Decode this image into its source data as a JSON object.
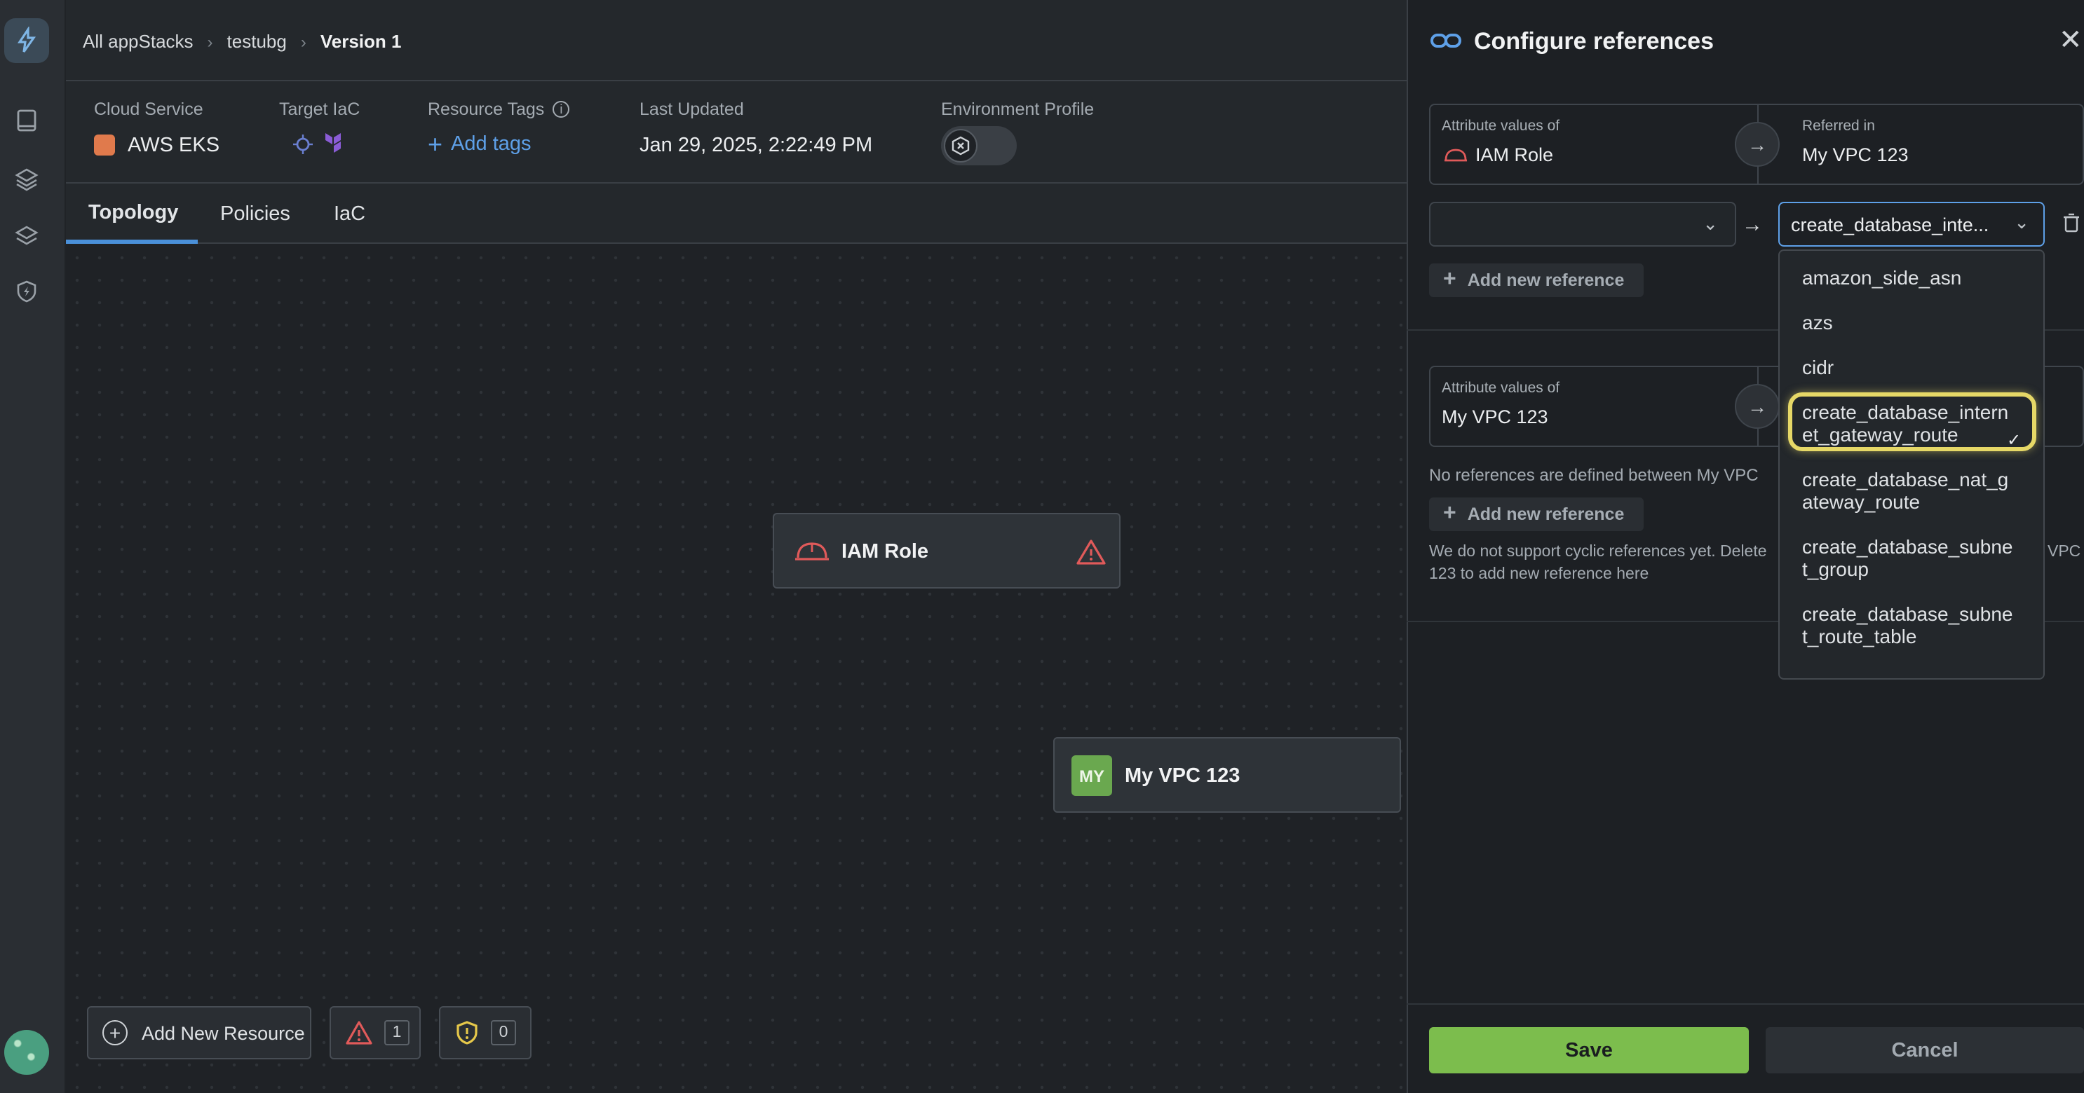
{
  "breadcrumb": [
    "All appStacks",
    "testubg",
    "Version 1"
  ],
  "info": {
    "cloud_service_label": "Cloud Service",
    "cloud_service_value": "AWS EKS",
    "target_iac_label": "Target IaC",
    "resource_tags_label": "Resource Tags",
    "add_tags": "Add tags",
    "last_updated_label": "Last Updated",
    "last_updated_value": "Jan 29, 2025, 2:22:49 PM",
    "env_profile_label": "Environment Profile"
  },
  "tabs": [
    "Topology",
    "Policies",
    "IaC"
  ],
  "canvas": {
    "node_iam": "IAM Role",
    "node_vpc_badge": "MY",
    "node_vpc": "My VPC 123",
    "add_resource": "Add New Resource",
    "warning_count": "1",
    "shield_count": "0"
  },
  "panel": {
    "title": "Configure references",
    "card1": {
      "from_label": "Attribute values of",
      "from_value": "IAM Role",
      "to_label": "Referred in",
      "to_value": "My VPC 123"
    },
    "select_value": "create_database_inte...",
    "add_ref": "Add new reference",
    "card2": {
      "from_label": "Attribute values of",
      "from_value": "My VPC 123"
    },
    "no_refs": "No references are defined between My VPC",
    "add_ref2": "Add new reference",
    "cyclic_line1": "We do not support cyclic references yet. Delete",
    "cyclic_line1_tail": "VPC",
    "cyclic_line2": "123 to add new reference here",
    "save": "Save",
    "cancel": "Cancel"
  },
  "dropdown": {
    "options": [
      "amazon_side_asn",
      "azs",
      "cidr",
      "create_database_internet_gateway_route",
      "create_database_nat_gateway_route",
      "create_database_subnet_group",
      "create_database_subnet_route_table"
    ],
    "option_lines": [
      [
        "amazon_side_asn"
      ],
      [
        "azs"
      ],
      [
        "cidr"
      ],
      [
        "create_database_intern",
        "et_gateway_route"
      ],
      [
        "create_database_nat_g",
        "ateway_route"
      ],
      [
        "create_database_subne",
        "t_group"
      ],
      [
        "create_database_subne",
        "t_route_table"
      ]
    ],
    "selected_index": 3
  },
  "colors": {
    "accent_blue": "#4a90d9",
    "save_green": "#7cbd4d",
    "warning_red": "#e05a5a",
    "highlight_yellow": "#e6d867"
  }
}
